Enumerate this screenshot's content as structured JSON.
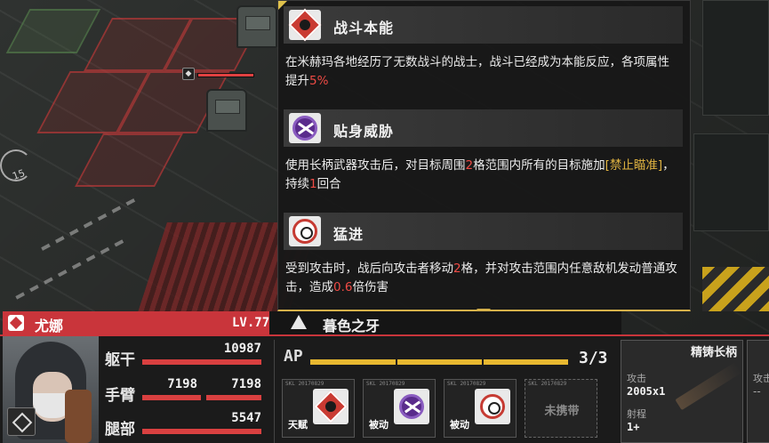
{
  "tooltip": {
    "skills": [
      {
        "name": "战斗本能",
        "icon": "instinct-diamond-icon",
        "desc_parts": [
          "在米赫玛各地经历了无数战斗的战士，战斗已经成为本能反应，各项属性提升",
          "5%",
          ""
        ]
      },
      {
        "name": "贴身威胁",
        "icon": "crossed-blades-purple-icon",
        "desc_parts": [
          "使用长柄武器攻击后，对目标周围",
          "2",
          "格范围内所有的目标施加",
          "[禁止瞄准]",
          "，持续",
          "1",
          "回合"
        ]
      },
      {
        "name": "猛进",
        "icon": "target-arrow-icon",
        "desc_parts": [
          "受到攻击时，战后向攻击者移动",
          "2",
          "格，并对攻击范围内任意敌机发动普通攻击，造成",
          "0.6",
          "倍伤害"
        ]
      }
    ]
  },
  "unit": {
    "name": "尤娜",
    "level": "LV.77",
    "team": "暮色之牙",
    "parts": {
      "body_label": "躯干",
      "body_value": "10987",
      "arm_label": "手臂",
      "arm_left": "7198",
      "arm_right": "7198",
      "leg_label": "腿部",
      "leg_value": "5547"
    }
  },
  "ap": {
    "label": "AP",
    "count": "3/3",
    "fill_fraction": 1.0,
    "segments": 3
  },
  "slots": [
    {
      "tag": "天赋",
      "code": "SKL 20170829",
      "icon": "instinct-diamond-icon"
    },
    {
      "tag": "被动",
      "code": "SKL 20170829",
      "icon": "crossed-blades-purple-icon"
    },
    {
      "tag": "被动",
      "code": "SKL 20170829",
      "icon": "target-arrow-icon"
    },
    {
      "empty_text": "未携带",
      "code": "SKL 20170829"
    }
  ],
  "weapon": {
    "name": "精铸长柄",
    "attack_label": "攻击",
    "attack_value": "2005x1",
    "range_label": "射程",
    "range_value": "1+"
  },
  "weapon2": {
    "attack_label": "攻击",
    "attack_value": "--"
  },
  "colors": {
    "accent_red": "#c9353b",
    "highlight_red": "#ef4b45",
    "highlight_gold": "#e0b341",
    "ap_yellow": "#e8b830"
  },
  "battlefield": {
    "gauge_value": "15"
  }
}
